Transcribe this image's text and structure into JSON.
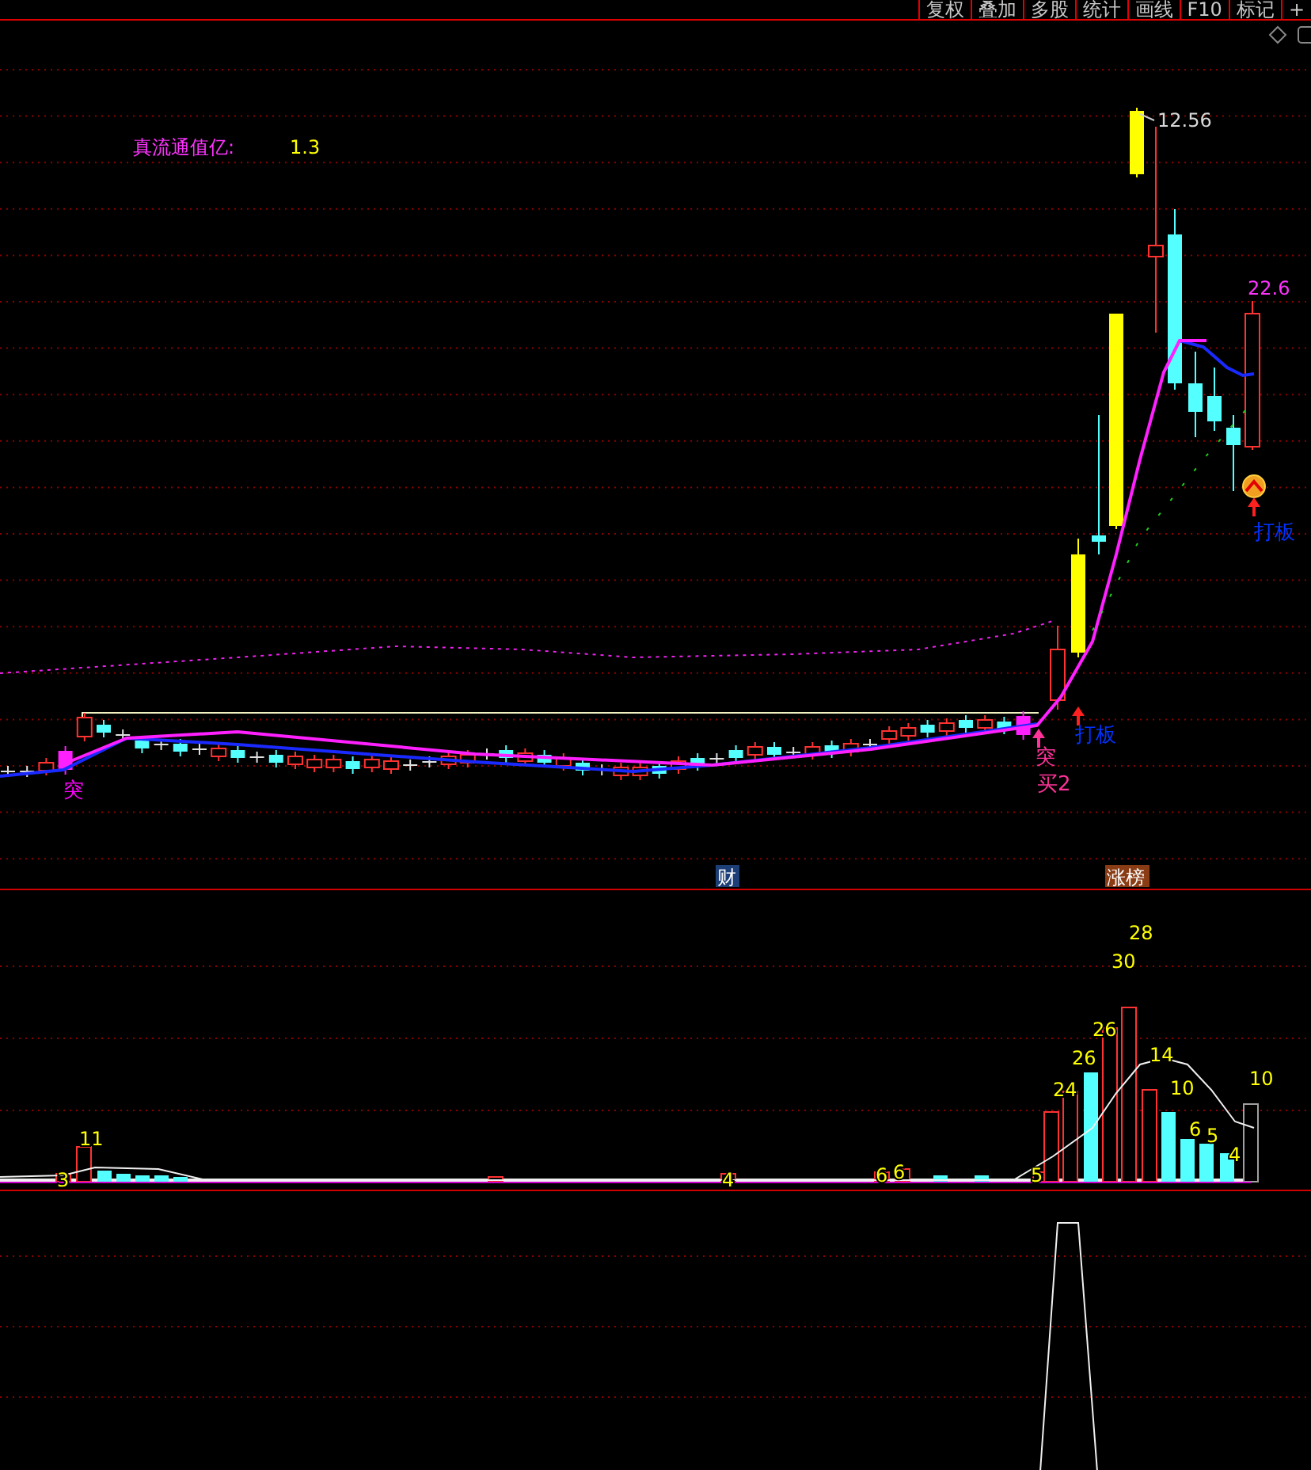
{
  "toolbar": {
    "buttons": [
      {
        "label": "复权"
      },
      {
        "label": "叠加"
      },
      {
        "label": "多股"
      },
      {
        "label": "统计"
      },
      {
        "label": "画线"
      },
      {
        "label": "F10"
      },
      {
        "label": "标记"
      },
      {
        "label": "+"
      }
    ]
  },
  "price_panel": {
    "indicator": {
      "label": "真流通值亿:",
      "value": "1.3"
    },
    "high_price": "12.56",
    "last_price": "22.6",
    "signals": [
      {
        "text": "突",
        "color": "#ff00ff",
        "kind": "plain"
      },
      {
        "text": "突",
        "color": "#ff3399",
        "kind": "arrow"
      },
      {
        "text": "买2",
        "color": "#ff3399",
        "kind": "plain"
      },
      {
        "text": "打板",
        "color": "#0033ff",
        "kind": "arrow"
      },
      {
        "text": "打板",
        "color": "#0033ff",
        "kind": "badge"
      }
    ],
    "tags": [
      {
        "text": "财",
        "color": "#1c3f77"
      },
      {
        "text": "涨榜",
        "color": "#8a3c14"
      }
    ]
  },
  "volume_panel": {
    "labels": [
      "11",
      "3",
      "4",
      "6",
      "6",
      "5",
      "24",
      "26",
      "26",
      "30",
      "28",
      "14",
      "10",
      "6",
      "5",
      "4",
      "10"
    ]
  }
}
